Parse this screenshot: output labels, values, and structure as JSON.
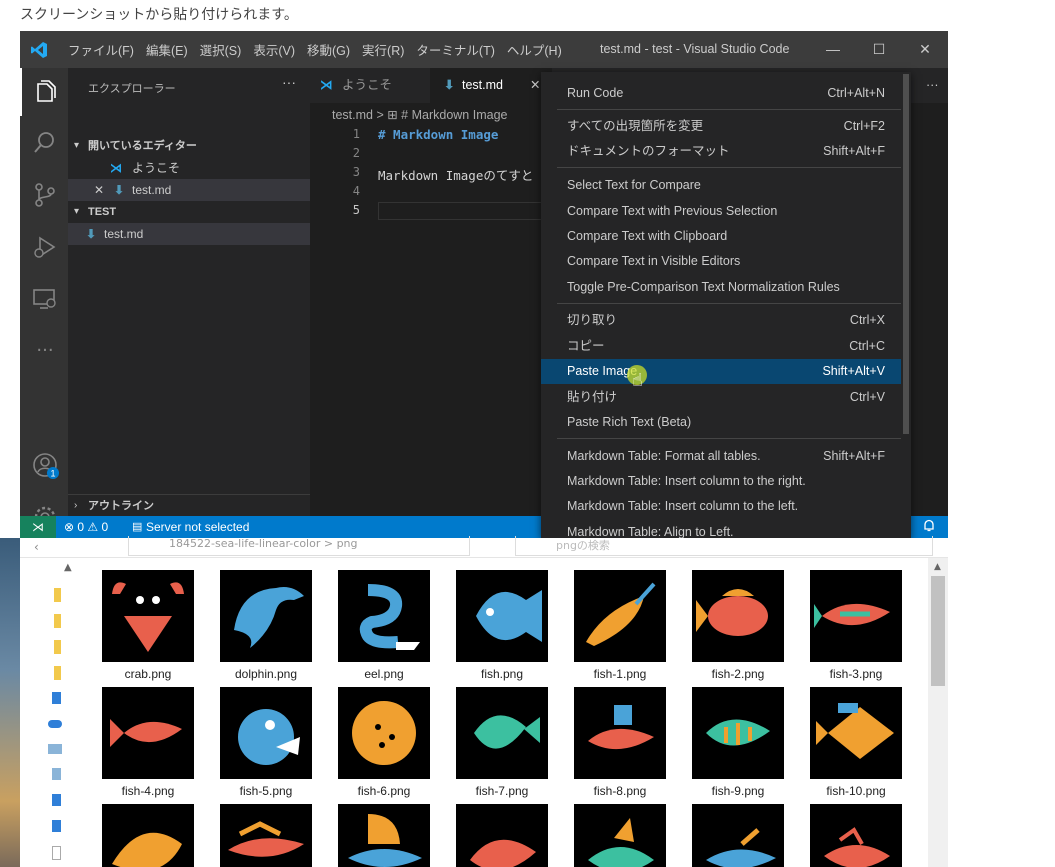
{
  "caption": "スクリーンショットから貼り付けられます。",
  "titlebar": {
    "menus": [
      "ファイル(F)",
      "編集(E)",
      "選択(S)",
      "表示(V)",
      "移動(G)",
      "実行(R)",
      "ターミナル(T)",
      "ヘルプ(H)"
    ],
    "title": "test.md - test - Visual Studio Code",
    "minimize": "—",
    "maximize": "☐",
    "close": "✕"
  },
  "sidebar": {
    "header": "エクスプローラー",
    "more": "···",
    "open_editors": "開いているエディター",
    "open_items": [
      "ようこそ",
      "test.md"
    ],
    "folder": "TEST",
    "folder_items": [
      "test.md"
    ],
    "outline": "アウトライン"
  },
  "tabs": {
    "welcome": "ようこそ",
    "active": "test.md",
    "close": "✕"
  },
  "editor": {
    "breadcrumb": "test.md > ⊞ # Markdown Image",
    "line_numbers": [
      "1",
      "2",
      "3",
      "4",
      "5"
    ],
    "lines": [
      "# Markdown Image",
      "",
      "Markdown Imageのてすと",
      "",
      ""
    ]
  },
  "statusbar": {
    "errors": "⊗ 0 ⚠ 0",
    "server": "Server not selected",
    "bell": "🔔"
  },
  "context_menu": {
    "items": [
      {
        "label": "Run Code",
        "key": "Ctrl+Alt+N"
      },
      {
        "label": "すべての出現箇所を変更",
        "key": "Ctrl+F2"
      },
      {
        "label": "ドキュメントのフォーマット",
        "key": "Shift+Alt+F"
      },
      {
        "label": "Select Text for Compare",
        "key": ""
      },
      {
        "label": "Compare Text with Previous Selection",
        "key": ""
      },
      {
        "label": "Compare Text with Clipboard",
        "key": ""
      },
      {
        "label": "Compare Text in Visible Editors",
        "key": ""
      },
      {
        "label": "Toggle Pre-Comparison Text Normalization Rules",
        "key": ""
      },
      {
        "label": "切り取り",
        "key": "Ctrl+X"
      },
      {
        "label": "コピー",
        "key": "Ctrl+C"
      },
      {
        "label": "Paste Image",
        "key": "Shift+Alt+V"
      },
      {
        "label": "貼り付け",
        "key": "Ctrl+V"
      },
      {
        "label": "Paste Rich Text (Beta)",
        "key": ""
      },
      {
        "label": "Markdown Table: Format all tables.",
        "key": "Shift+Alt+F"
      },
      {
        "label": "Markdown Table: Insert column to the right.",
        "key": ""
      },
      {
        "label": "Markdown Table: Insert column to the left.",
        "key": ""
      },
      {
        "label": "Markdown Table: Align to Left.",
        "key": ""
      }
    ]
  },
  "explorer": {
    "path": "184522-sea-life-linear-color > png",
    "search_placeholder": "pngの検索",
    "files": [
      "crab.png",
      "dolphin.png",
      "eel.png",
      "fish.png",
      "fish-1.png",
      "fish-2.png",
      "fish-3.png",
      "fish-4.png",
      "fish-5.png",
      "fish-6.png",
      "fish-7.png",
      "fish-8.png",
      "fish-9.png",
      "fish-10.png",
      "",
      "",
      "",
      "",
      "",
      "",
      ""
    ]
  },
  "colors": {
    "accent": "#007acc",
    "highlight": "#094771",
    "remote": "#16825d"
  }
}
